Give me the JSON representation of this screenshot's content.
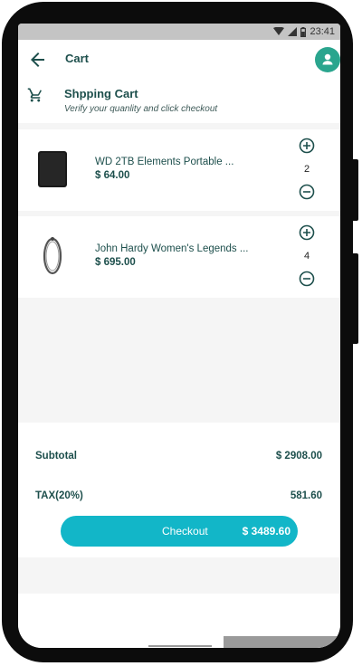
{
  "status_bar": {
    "time": "23:41"
  },
  "app_bar": {
    "title": "Cart"
  },
  "header": {
    "title": "Shpping Cart",
    "subtitle": "Verify your quanlity  and click checkout"
  },
  "items": [
    {
      "name": "WD 2TB Elements Portable ...",
      "price": "$ 64.00",
      "quantity": "2"
    },
    {
      "name": "John Hardy Women's Legends ...",
      "price": "$ 695.00",
      "quantity": "4"
    }
  ],
  "summary": {
    "subtotal_label": "Subtotal",
    "subtotal_value": "$ 2908.00",
    "tax_label": "TAX(20%)",
    "tax_value": "581.60"
  },
  "checkout": {
    "label": "Checkout",
    "total": "$ 3489.60"
  },
  "colors": {
    "accent": "#2aa58e",
    "checkout": "#12b6c8",
    "text_dark": "#1d4f4c"
  }
}
